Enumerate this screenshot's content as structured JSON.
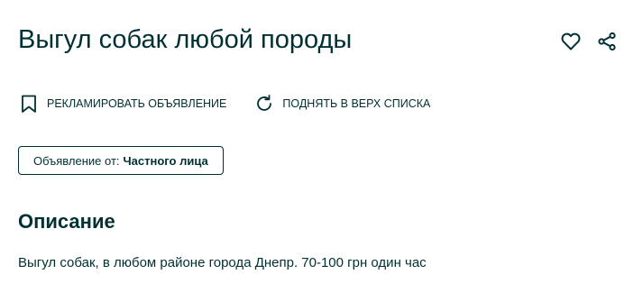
{
  "listing": {
    "title": "Выгул собак любой породы"
  },
  "header_icons": {
    "favorite": "heart-icon",
    "share": "share-icon"
  },
  "actions": {
    "promote_label": "РЕКЛАМИРОВАТЬ ОБЪЯВЛЕНИЕ",
    "promote_icon": "bookmark-icon",
    "refresh_label": "ПОДНЯТЬ В ВЕРХ СПИСКА",
    "refresh_icon": "refresh-icon"
  },
  "seller": {
    "prefix": "Объявление от:",
    "type": "Частного лица"
  },
  "description": {
    "heading": "Описание",
    "text": "Выгул собак, в любом районе города Днепр. 70-100 грн один час"
  },
  "colors": {
    "text": "#002f34",
    "background": "#ffffff"
  }
}
